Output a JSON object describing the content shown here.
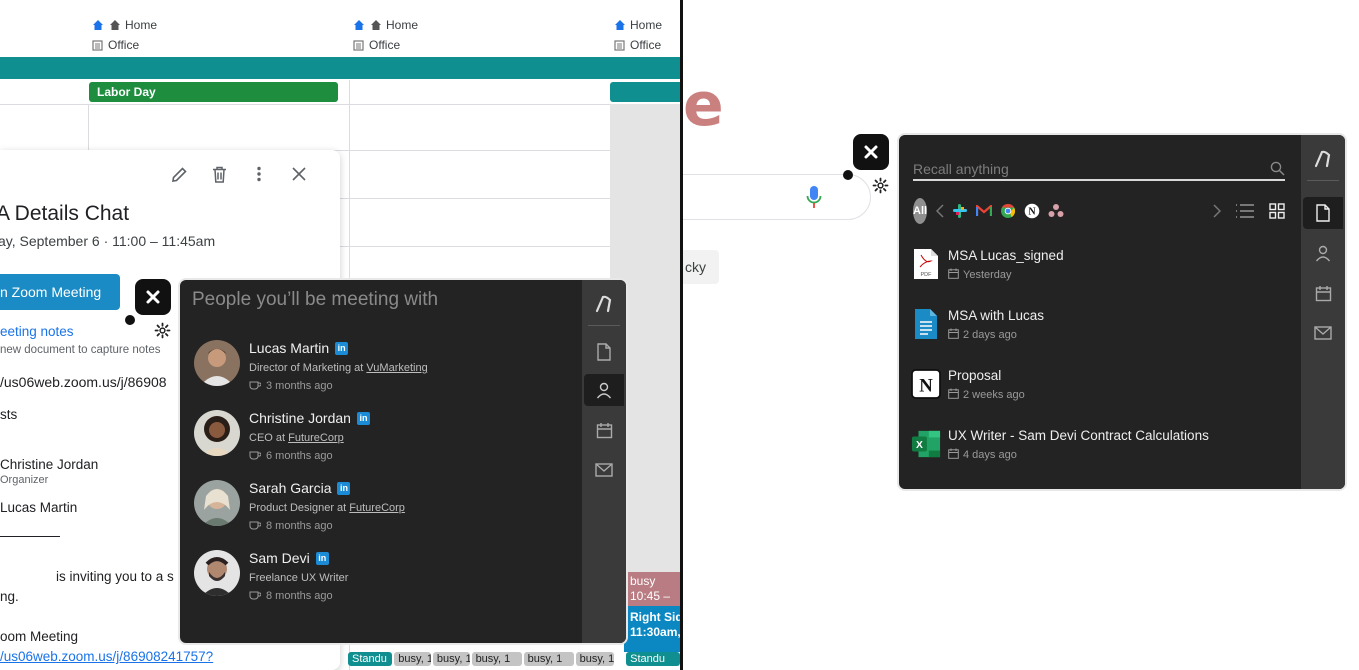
{
  "calendar": {
    "locations": [
      {
        "home": "Home",
        "office": "Office"
      },
      {
        "home": "Home",
        "office": "Office"
      },
      {
        "home": "Home",
        "office": "Office"
      }
    ],
    "holiday": "Labor Day",
    "event": {
      "title": "A Details Chat",
      "date": "ay, September 6   ·  11:00 – 11:45am",
      "join_button": "n Zoom Meeting",
      "notes_link": "eeting notes",
      "notes_sub": "new document to capture notes",
      "zoom_url": "/us06web.zoom.us/j/86908",
      "guests_label": "sts",
      "guest1_name": "Christine Jordan",
      "guest1_role": "Organizer",
      "guest2_name": "Lucas Martin",
      "inviting_text": "is inviting you to a s",
      "ng_text": "ng.",
      "zoom_meeting_label": "oom Meeting",
      "zoom_url2": "/us06web.zoom.us/j/86908241757?"
    },
    "busy_block": {
      "label": "busy",
      "time": "10:45 –"
    },
    "right_side_block": {
      "line1": "Right Sid",
      "line2": "11:30am,"
    },
    "bottom_chips": [
      "Standu",
      "busy, 1",
      "busy, 1",
      "busy, 1",
      "busy, 1",
      "busy, 1",
      "Standu"
    ]
  },
  "people_widget": {
    "heading": "People you’ll be meeting with",
    "people": [
      {
        "name": "Lucas Martin",
        "role": "Director of Marketing at ",
        "company": "VuMarketing",
        "last_met": "3 months ago"
      },
      {
        "name": "Christine Jordan",
        "role": "CEO at ",
        "company": "FutureCorp",
        "last_met": "6 months ago"
      },
      {
        "name": "Sarah Garcia",
        "role": "Product Designer at ",
        "company": "FutureCorp",
        "last_met": "8 months ago"
      },
      {
        "name": "Sam Devi",
        "role": "Freelance UX Writer",
        "company": "",
        "last_met": "8 months ago"
      }
    ]
  },
  "recall_widget": {
    "search_placeholder": "Recall anything",
    "all_label": "All",
    "documents": [
      {
        "title": "MSA Lucas_signed",
        "time": "Yesterday",
        "icon": "pdf-icon"
      },
      {
        "title": "MSA with Lucas",
        "time": "2 days ago",
        "icon": "google-doc-icon"
      },
      {
        "title": "Proposal",
        "time": "2 weeks ago",
        "icon": "notion-icon"
      },
      {
        "title": "UX Writer - Sam Devi Contract Calculations",
        "time": "4 days ago",
        "icon": "excel-icon"
      }
    ]
  },
  "google": {
    "lucky_text": "cky"
  },
  "colors": {
    "teal": "#0f8f8f",
    "holiday_green": "#1e8e3e",
    "panel_dark": "#232323",
    "linkedin_blue": "#1b8bd6"
  }
}
